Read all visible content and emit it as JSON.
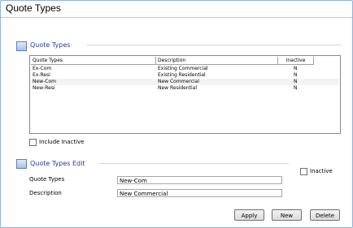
{
  "window": {
    "title": "Quote Types"
  },
  "list_section": {
    "title": "Quote Types"
  },
  "listview": {
    "columns": [
      "Quote Types",
      "Description",
      "Inactive"
    ],
    "rows": [
      {
        "type": "Ex-Com",
        "description": "Existing Commercial",
        "inactive": "N"
      },
      {
        "type": "Ex-Resi",
        "description": "Existing Residential",
        "inactive": "N"
      },
      {
        "type": "New-Com",
        "description": "New Commercial",
        "inactive": "N"
      },
      {
        "type": "New-Resi",
        "description": "New Residential",
        "inactive": "N"
      }
    ]
  },
  "include_inactive": {
    "label": "Include Inactive",
    "checked": false
  },
  "edit_section": {
    "title": "Quote Types Edit",
    "inactive_label": "Inactive",
    "inactive_checked": false,
    "quote_types_label": "Quote Types",
    "quote_types_value": "New-Com",
    "description_label": "Description",
    "description_value": "New Commercial"
  },
  "buttons": {
    "apply": "Apply",
    "new": "New",
    "delete": "Delete"
  },
  "colors": {
    "section_title": "#1f3ca0",
    "border": "#8db2e3"
  }
}
